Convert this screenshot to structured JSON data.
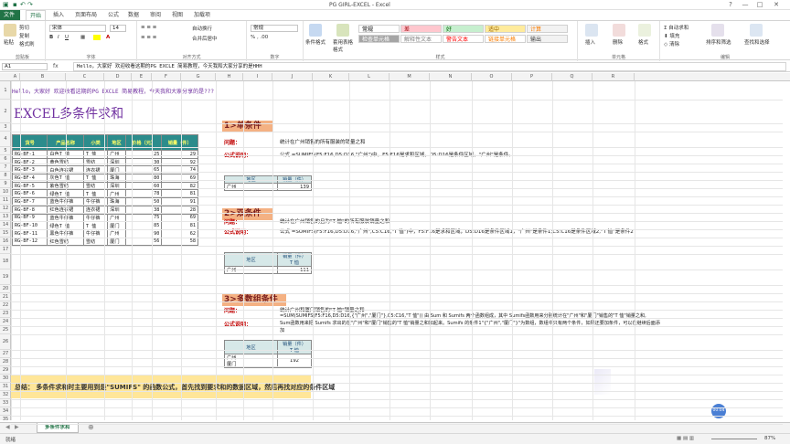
{
  "window": {
    "title": "PG GIRL-EXCEL - Excel",
    "help": "?",
    "min": "—",
    "max": "□",
    "close": "✕",
    "user": "tao"
  },
  "tabs": [
    "文件",
    "开始",
    "插入",
    "页面布局",
    "公式",
    "数据",
    "审阅",
    "视图",
    "加载项"
  ],
  "ribbon": {
    "clipboard": {
      "paste": "粘贴",
      "cut": "剪切",
      "copy": "复制",
      "painter": "格式刷",
      "label": "剪贴板"
    },
    "font": {
      "name": "宋体",
      "size": "14",
      "label": "字体"
    },
    "align": {
      "wrap": "自动换行",
      "merge": "合并后居中",
      "label": "对齐方式"
    },
    "number": {
      "format": "常规",
      "label": "数字"
    },
    "styles": {
      "cond": "条件格式",
      "table": "套用表格格式",
      "cells": [
        {
          "t": "常规",
          "bg": "#ffffff",
          "fg": "#000"
        },
        {
          "t": "差",
          "bg": "#ffc7ce",
          "fg": "#9c0006"
        },
        {
          "t": "好",
          "bg": "#c6efce",
          "fg": "#006100"
        },
        {
          "t": "适中",
          "bg": "#ffeb9c",
          "fg": "#9c6500"
        },
        {
          "t": "计算",
          "bg": "#f2f2f2",
          "fg": "#fa7d00"
        },
        {
          "t": "检查单元格",
          "bg": "#a5a5a5",
          "fg": "#ffffff"
        },
        {
          "t": "解释性文本",
          "bg": "#ffffff",
          "fg": "#7f7f7f"
        },
        {
          "t": "警告文本",
          "bg": "#ffffff",
          "fg": "#ff0000"
        },
        {
          "t": "链接单元格",
          "bg": "#ffffff",
          "fg": "#fa7d00"
        },
        {
          "t": "输出",
          "bg": "#f2f2f2",
          "fg": "#3f3f3f"
        }
      ],
      "label": "样式"
    },
    "cells": {
      "insert": "插入",
      "delete": "删除",
      "format": "格式",
      "label": "单元格"
    },
    "editing": {
      "autosum": "自动求和",
      "fill": "填充",
      "clear": "清除",
      "sort": "排序和筛选",
      "find": "查找和选择",
      "label": "编辑"
    }
  },
  "formula_bar": {
    "namebox": "A1",
    "fx": "fx",
    "value": "Hello，大家好 欢迎收看这期的PG EXCLE 简易教程，今天我和大家分享的是HHH"
  },
  "columns": [
    "A",
    "B",
    "C",
    "D",
    "E",
    "F",
    "G",
    "H",
    "I",
    "J",
    "K",
    "L",
    "M",
    "N",
    "O",
    "P",
    "Q",
    "R"
  ],
  "sheet": {
    "greeting": "Hello，大家好 欢迎收看这期的PG EXCLE 简易教程，今天我和大家分享的是???",
    "title": "EXCEL多条件求和",
    "table": {
      "headers": [
        "货号",
        "产品名称",
        "小类",
        "地区",
        "价格（元）",
        "销量（件）"
      ],
      "rows": [
        [
          "RG-BF-1",
          "白色T 恤",
          "T 恤",
          "广州",
          "25",
          "29"
        ],
        [
          "RG-BF-2",
          "黄色雪纺",
          "雪纺",
          "深圳",
          "30",
          "92"
        ],
        [
          "RG-BF-3",
          "白色连衣裙",
          "连衣裙",
          "厦门",
          "65",
          "74"
        ],
        [
          "RG-BF-4",
          "灰色T 恤",
          "T 恤",
          "珠海",
          "80",
          "69"
        ],
        [
          "RG-BF-5",
          "紫色雪纺",
          "雪纺",
          "深圳",
          "60",
          "82"
        ],
        [
          "RG-BF-6",
          "绿色T 恤",
          "T 恤",
          "广州",
          "78",
          "81"
        ],
        [
          "RG-BF-7",
          "蓝色牛仔裤",
          "牛仔裤",
          "珠海",
          "50",
          "91"
        ],
        [
          "RG-BF-8",
          "红色连衣裙",
          "连衣裙",
          "深圳",
          "38",
          "28"
        ],
        [
          "RG-BF-9",
          "蓝色牛仔裤",
          "牛仔裤",
          "广州",
          "75",
          "69"
        ],
        [
          "RG-BF-10",
          "绿色T 恤",
          "T 恤",
          "厦门",
          "85",
          "81"
        ],
        [
          "RG-BF-11",
          "黑色牛仔裤",
          "牛仔裤",
          "广州",
          "90",
          "62"
        ],
        [
          "RG-BF-12",
          "红色雪纺",
          "雪纺",
          "厦门",
          "56",
          "58"
        ]
      ]
    },
    "s1": {
      "head": "1>单条件",
      "q": "问题：",
      "qtext": "统计在广州销售的所有服装的销量之和",
      "f": "公式说明：",
      "ftext": "公式 =SUMIFS(F5:F16,D5:D16,\"广州\")中，F5:F16是求和区域，D5:D16是条件区域，\"广州\"是条件。",
      "th1": "地区",
      "th2": "销量（件）",
      "v1": "广州",
      "v2": "139"
    },
    "s2": {
      "head": "2>双条件",
      "qtext": "统计在广州销售的且为\"T 恤\"的所有服装销量之和",
      "ftext": "公式 =SUMIFS(F5:F16,D5:D16,\"广州\",C5:C16,\"T 恤\")中，F5:F16是求和区域，D5:D16是条件区域1，\"广州\"是条件1;C5:C16是条件区域2,\"T 恤\"是条件2",
      "th1": "地区",
      "th2": "销量（件）",
      "th3": "T 恤",
      "v1": "广州",
      "v2": "111"
    },
    "s3": {
      "head": "3>多数组条件",
      "qtext": "统计广州和厦门销售的\"T 恤\"销量之和",
      "ftext1": "=SUM(SUMIFS(F5:F16,D5:D16,{\"广州\",\"厦门\"},C5:C16,\"T 恤\")) 由 Sum 和 Sumifs 两个函数组成，其中 Sumifs函数用来分别统计在\"广州\"和\"厦门\"销售的\"T 恤\"销量之和,",
      "ftext2": "Sum函数用来把 Sumifs 求出的在\"广州\"和\"厦门\"销售的\"T 恤\"销量之和加起来。Sumifs 的条件1\"{\"广州\",\"厦门\"}\"为数组，数组中只有两个条件，如果还要加条件，可以在继续后面添",
      "ftext3": "加",
      "th1": "地区",
      "th2": "销量（件）",
      "th3": "T 恤",
      "v1": "广州",
      "v1b": "厦门",
      "v2": "192"
    },
    "summary": "总结： 多条件求和时主要用到是\"SUMIFS\" 的函数公式，首先找到要求和的数据区域，然后再找对应的条件区域"
  },
  "sheet_tab": "多条件求和",
  "status": {
    "ready": "就绪",
    "zoom": "87%",
    "badge": "00:04"
  }
}
